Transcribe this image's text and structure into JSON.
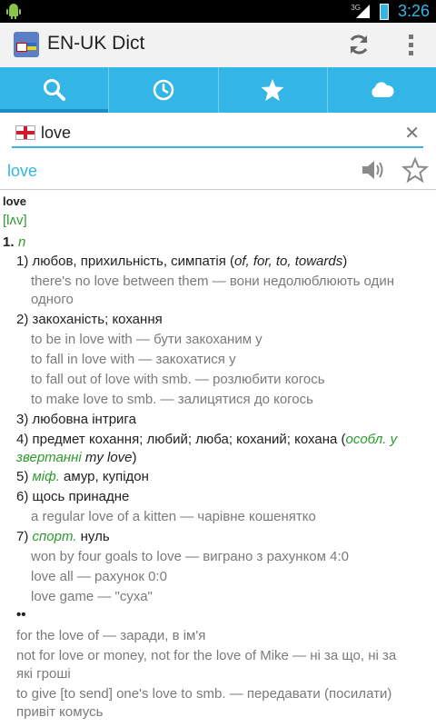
{
  "status": {
    "network": "3G",
    "time": "3:26"
  },
  "app": {
    "title": "EN-UK Dict"
  },
  "search": {
    "value": "love"
  },
  "header": {
    "word": "love"
  },
  "entry": {
    "headword": "love",
    "transcription": "[lʌv]",
    "pos_number": "1.",
    "pos": "n",
    "senses": {
      "s1_num": "1)",
      "s1_text": "любов, прихильність, симпатія (",
      "s1_prep": "of, for, to, towards",
      "s1_close": ")",
      "s1_ex1": "there's no love between them — вони недолюблюють один",
      "s1_ex1b": "одного",
      "s2_num": "2)",
      "s2_text": "закоханість; кохання",
      "s2_ex1": "to be in love with — бути закоханим у",
      "s2_ex2": "to fall in love with — закохатися у",
      "s2_ex3": "to fall out of love with smb. — розлюбити когось",
      "s2_ex4": "to make love to smb. — залицятися до когось",
      "s3_num": "3)",
      "s3_text": "любовна інтрига",
      "s4_num": "4)",
      "s4_text": "предмет кохання; любий; люба; коханий; кохана (",
      "s4_label": "особл. у",
      "s4_label2": "звертанні",
      "s4_tail_ital": "my love",
      "s4_close": ")",
      "s5_num": "5)",
      "s5_label": "міф.",
      "s5_text": "амур, купідон",
      "s6_num": "6)",
      "s6_text": "щось принадне",
      "s6_ex1": "a regular love of a kitten — чарівне кошенятко",
      "s7_num": "7)",
      "s7_label": "спорт.",
      "s7_text": "нуль",
      "s7_ex1": "won by four goals to love — виграно з рахунком 4:0",
      "s7_ex2": "love all — рахунок 0:0",
      "s7_ex3": "love game — \"суха\""
    },
    "idioms_marker": "••",
    "idioms": {
      "i1": "for the love of — заради, в ім'я",
      "i2": "not for love or money, not for the love of Mike — ні за що, ні за",
      "i2b": "які гроші",
      "i3": "to give [to send] one's love to smb. — передавати (посилати)",
      "i3b": "привіт комусь"
    }
  }
}
